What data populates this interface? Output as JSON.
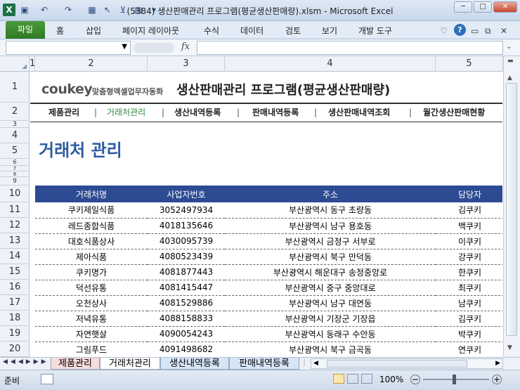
{
  "window": {
    "title": "(5384) 생산판매관리 프로그램(평균생산판매량).xlsm  -  Microsoft Excel",
    "app_icon": "excel-icon"
  },
  "ribbon": {
    "file": "파일",
    "tabs": [
      "홈",
      "삽입",
      "페이지 레이아웃",
      "수식",
      "데이터",
      "검토",
      "보기",
      "개발 도구"
    ]
  },
  "formula_bar": {
    "fx": "fx"
  },
  "columns": [
    "1",
    "2",
    "3",
    "4",
    "5"
  ],
  "rows": [
    "1",
    "2",
    "3",
    "4",
    "5",
    "6",
    "7",
    "8",
    "9",
    "10",
    "11",
    "12",
    "13",
    "14",
    "15",
    "16",
    "17",
    "18",
    "19",
    "20"
  ],
  "sheet": {
    "logo": {
      "brand": "coukey",
      "tagline": "맞춤형엑셀업무자동화"
    },
    "app_title": "생산판매관리 프로그램(평균생산판매량)",
    "nav": [
      "제품관리",
      "거래처관리",
      "생산내역등록",
      "판매내역등록",
      "생산판매내역조회",
      "월간생산판매현황"
    ],
    "nav_active": "거래처관리",
    "nav_active_color": "#2e8b3d",
    "page_title": "거래처 관리",
    "header_color": "#2c4b93",
    "table": {
      "headers": [
        "거래처명",
        "사업자번호",
        "주소",
        "담당자"
      ],
      "rows": [
        [
          "쿠키제일식품",
          "3052497934",
          "부산광역시 동구 초량동",
          "김쿠키"
        ],
        [
          "레드종합식품",
          "4018135646",
          "부산광역시 남구 용호동",
          "백쿠키"
        ],
        [
          "대호식품상사",
          "4030095739",
          "부산광역시 금정구 서부로",
          "이쿠키"
        ],
        [
          "제아식품",
          "4080523439",
          "부산광역시 북구 만덕동",
          "강쿠키"
        ],
        [
          "쿠키명가",
          "4081877443",
          "부산광역시 해운대구 송정중앙로",
          "한쿠키"
        ],
        [
          "덕선유통",
          "4081415447",
          "부산광역시 중구 중앙대로",
          "최쿠키"
        ],
        [
          "오천상사",
          "4081529886",
          "부산광역시 남구 대연동",
          "남쿠키"
        ],
        [
          "저녁유통",
          "4088158833",
          "부산광역시 기장군 기장읍",
          "김쿠키"
        ],
        [
          "자연햇살",
          "4090054243",
          "부산광역시 동래구 수안동",
          "박쿠키"
        ],
        [
          "그림푸드",
          "4091498682",
          "부산광역시 북구 금곡동",
          "연쿠키"
        ]
      ]
    }
  },
  "sheet_tabs": [
    "제품관리",
    "거래처관리",
    "생산내역등록",
    "판매내역등록"
  ],
  "active_sheet": "거래처관리",
  "status": {
    "ready": "준비",
    "zoom": "100%"
  }
}
